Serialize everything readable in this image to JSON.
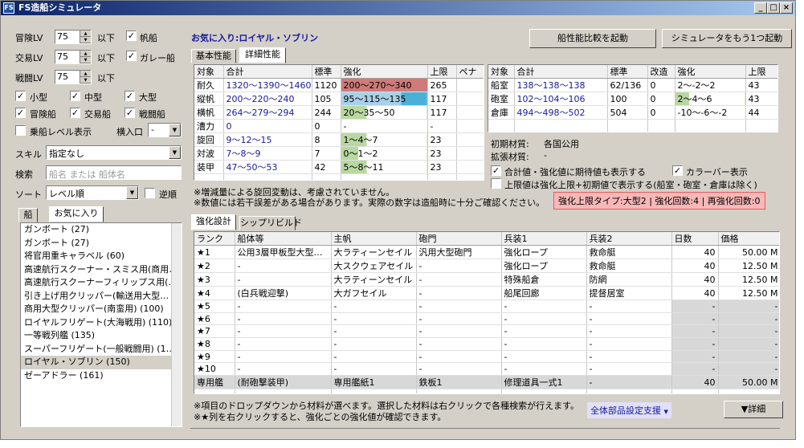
{
  "window": {
    "title": "FS造船シミュレータ",
    "icon": "FS",
    "min": "_",
    "max": "□",
    "close": "×"
  },
  "left": {
    "adv_lv_label": "冒険LV",
    "adv_lv_value": "75",
    "adv_lv_suffix": "以下",
    "adv_lv_check_label": "帆船",
    "trade_lv_label": "交易LV",
    "trade_lv_value": "75",
    "trade_lv_suffix": "以下",
    "trade_lv_check_label": "ガレー船",
    "battle_lv_label": "戦闘LV",
    "battle_lv_value": "75",
    "battle_lv_suffix": "以下",
    "size_small": "小型",
    "size_medium": "中型",
    "size_large": "大型",
    "type_adv": "冒険船",
    "type_trade": "交易船",
    "type_battle": "戦闘船",
    "ship_level_label": "乗船レベル表示",
    "lateral_label": "横入口",
    "lateral_value": "-",
    "skill_label": "スキル",
    "skill_value": "指定なし",
    "search_label": "検索",
    "search_placeholder": "船名 または 船体名",
    "sort_label": "ソート",
    "sort_value": "レベル順",
    "reverse_label": "逆順",
    "tabs": [
      "船",
      "お気に入り"
    ],
    "ships": [
      "ガンボート (27)",
      "ガンボート (27)",
      "将官用重キャラベル (60)",
      "高速航行スクーナー・スミス用(商用…",
      "高速航行スクーナーフィリップス用(…",
      "引き上げ用クリッパー(輸送用大型…",
      "商用大型クリッパー(南蛮用) (100)",
      "ロイヤルフリゲート(大海戦用) (110)",
      "一等戦列艦 (135)",
      "スーパーフリゲート(一般戦闘用) (1…",
      "ロイヤル・ソブリン (150)",
      "ゼーアドラー (161)"
    ],
    "selected_index": 10
  },
  "header": {
    "favorite_title": "お気に入り:ロイヤル・ソブリン",
    "compare_button": "船性能比較を起動",
    "launch_button": "シミュレータをもう1つ起動"
  },
  "perf_tabs": [
    "基本性能",
    "詳細性能"
  ],
  "perf_table": {
    "headers": [
      "対象",
      "合計",
      "標準",
      "強化",
      "上限",
      "ペナ"
    ],
    "rows": [
      [
        "耐久",
        "1320〜1390〜1460",
        "1120",
        "200〜270〜340",
        "265",
        ""
      ],
      [
        "縦帆",
        "200〜220〜240",
        "105",
        "95〜115〜135",
        "117",
        ""
      ],
      [
        "横帆",
        "264〜279〜294",
        "244",
        "20〜35〜50",
        "117",
        ""
      ],
      [
        "漕力",
        "0",
        "0",
        "-",
        "-",
        ""
      ],
      [
        "旋回",
        "9〜12〜15",
        "8",
        "1〜4〜7",
        "23",
        ""
      ],
      [
        "対波",
        "7〜8〜9",
        "7",
        "0〜1〜2",
        "23",
        ""
      ],
      [
        "装甲",
        "47〜50〜53",
        "42",
        "5〜8〜11",
        "23",
        ""
      ]
    ]
  },
  "room_table": {
    "headers": [
      "対象",
      "合計",
      "標準",
      "改造",
      "強化",
      "上限"
    ],
    "rows": [
      [
        "船室",
        "138〜138〜138",
        "62/136",
        "0",
        "2〜-2〜2",
        "43"
      ],
      [
        "砲室",
        "102〜104〜106",
        "100",
        "0",
        "2〜4〜6",
        "43"
      ],
      [
        "倉庫",
        "494〜498〜502",
        "504",
        "0",
        "-10〜-6〜-2",
        "44"
      ]
    ]
  },
  "materials": {
    "initial_label": "初期材質:",
    "initial_value": "各国公用",
    "extended_label": "拡張材質:",
    "extended_value": "-",
    "check_expect": "合計値・強化値に期待値も表示する",
    "check_color": "カラーバー表示",
    "check_limit": "上限値は強化上限+初期値で表示する(船室・砲室・倉庫は除く)"
  },
  "notes": {
    "n1": "※増減量による旋回変動は、考慮されていません。",
    "n2": "※数値には若干誤差がある場合があります。実際の数字は造船時に十分ご確認ください。"
  },
  "enhance_limit_box": "強化上限タイプ:大型2 | 強化回数:4 | 再強化回数:0",
  "build_tabs": [
    "強化設計",
    "シップリビルド"
  ],
  "build_table": {
    "headers": [
      "ランク",
      "船体等",
      "主帆",
      "砲門",
      "兵装1",
      "兵装2",
      "日数",
      "価格"
    ],
    "rows": [
      [
        "★1",
        "公用3層甲板型大型…",
        "大ラティーンセイル",
        "汎用大型砲門",
        "強化ロープ",
        "救命艇",
        "40",
        "50.00 M"
      ],
      [
        "★2",
        "-",
        "大スクウェアセイル",
        "-",
        "強化ロープ",
        "救命艇",
        "40",
        "12.50 M"
      ],
      [
        "★3",
        "-",
        "大ラティーンセイル",
        "-",
        "特殊船倉",
        "防網",
        "40",
        "12.50 M"
      ],
      [
        "★4",
        "(白兵戦迎撃)",
        "大ガフセイル",
        "-",
        "船尾回廊",
        "提督居室",
        "40",
        "12.50 M"
      ],
      [
        "★5",
        "-",
        "-",
        "-",
        "-",
        "-",
        "-",
        "-"
      ],
      [
        "★6",
        "-",
        "-",
        "-",
        "-",
        "-",
        "-",
        "-"
      ],
      [
        "★7",
        "-",
        "-",
        "-",
        "-",
        "-",
        "-",
        "-"
      ],
      [
        "★8",
        "-",
        "-",
        "-",
        "-",
        "-",
        "-",
        "-"
      ],
      [
        "★9",
        "-",
        "-",
        "-",
        "-",
        "-",
        "-",
        "-"
      ],
      [
        "★10",
        "-",
        "-",
        "-",
        "-",
        "-",
        "-",
        "-"
      ],
      [
        "専用艦",
        "(耐砲撃装甲)",
        "専用艦紙1",
        "鉄板1",
        "修理道具一式1",
        "-",
        "40",
        "50.00 M"
      ]
    ]
  },
  "footer": {
    "n1": "※項目のドロップダウンから材料が選べます。選択した材料は右クリックで各種検索が行えます。",
    "n2": "※★列を右クリックすると、強化ごとの強化値が確認できます。",
    "support_button": "全体部品設定支援",
    "detail_button": "▼詳細"
  },
  "icons": {
    "check": "✓",
    "dropdown": "▼",
    "spin_up": "▲",
    "spin_down": "▼"
  }
}
